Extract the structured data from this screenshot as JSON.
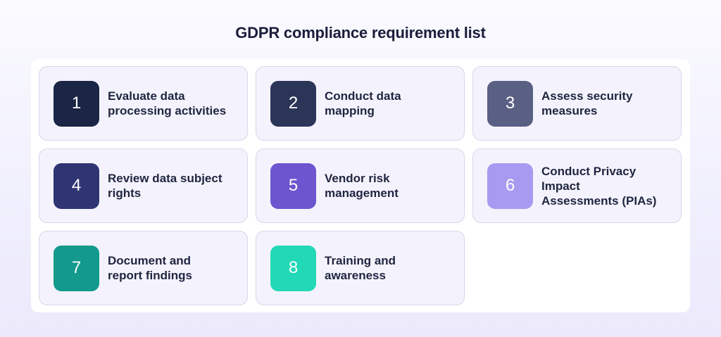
{
  "title": "GDPR compliance requirement list",
  "items": [
    {
      "number": "1",
      "label": "Evaluate data\nprocessing activities",
      "color": "#1b2545"
    },
    {
      "number": "2",
      "label": "Conduct data\nmapping",
      "color": "#2b3558"
    },
    {
      "number": "3",
      "label": "Assess security\nmeasures",
      "color": "#5a6083"
    },
    {
      "number": "4",
      "label": "Review data subject\nrights",
      "color": "#2f3472"
    },
    {
      "number": "5",
      "label": "Vendor risk\nmanagement",
      "color": "#6c55cf"
    },
    {
      "number": "6",
      "label": "Conduct Privacy\nImpact\nAssessments (PIAs)",
      "color": "#a89af0"
    },
    {
      "number": "7",
      "label": "Document and\nreport findings",
      "color": "#139a8c"
    },
    {
      "number": "8",
      "label": "Training and\nawareness",
      "color": "#22d8b6"
    }
  ]
}
